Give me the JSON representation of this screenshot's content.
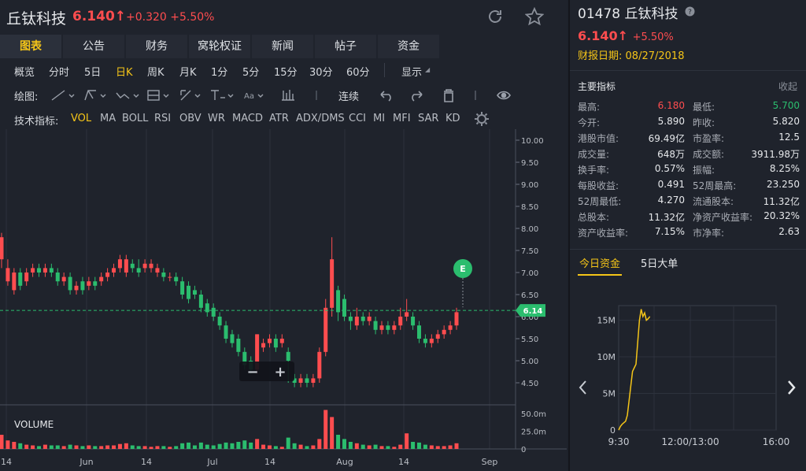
{
  "header": {
    "name": "丘钛科技",
    "price": "6.140",
    "change": "+0.320",
    "change_pct": "+5.50%"
  },
  "tabs": [
    "图表",
    "公告",
    "财务",
    "窝轮权证",
    "新闻",
    "帖子",
    "资金"
  ],
  "active_tab": 0,
  "periods": [
    "概览",
    "分时",
    "5日",
    "日K",
    "周K",
    "月K",
    "1分",
    "5分",
    "15分",
    "30分",
    "60分",
    "显示"
  ],
  "active_period": 3,
  "draw": {
    "label": "绘图:",
    "continuous": "连续"
  },
  "indicators": {
    "label": "技术指标:",
    "items": [
      "VOL",
      "MA",
      "BOLL",
      "RSI",
      "OBV",
      "WR",
      "MACD",
      "ATR",
      "ADX/DMS",
      "CCI",
      "MI",
      "MFI",
      "SAR",
      "KD"
    ],
    "active": 0
  },
  "chart_data": {
    "type": "candlestick",
    "price_axis": {
      "ticks": [
        "10.00",
        "9.50",
        "9.00",
        "8.50",
        "8.00",
        "7.50",
        "7.00",
        "6.50",
        "6.00",
        "5.50",
        "5.00",
        "4.50"
      ],
      "range": [
        4.0,
        10.25
      ]
    },
    "volume_axis": {
      "ticks": [
        "50.0m",
        "25.0m",
        "0"
      ],
      "range": [
        0,
        60
      ]
    },
    "x_labels": [
      "14",
      "Jun",
      "14",
      "Jul",
      "14",
      "Aug",
      "14",
      "Sep"
    ],
    "last_price_label": "6.14",
    "last_price": 6.14,
    "earnings_marker": "E",
    "volume_label": "VOLUME",
    "zoom_minus": "−",
    "zoom_plus": "+",
    "candles": [
      [
        7.3,
        7.8,
        7.9,
        7.1,
        20
      ],
      [
        6.8,
        7.1,
        7.3,
        6.7,
        12
      ],
      [
        6.6,
        7.0,
        7.1,
        6.5,
        10
      ],
      [
        7.0,
        6.7,
        7.1,
        6.6,
        8
      ],
      [
        6.8,
        7.0,
        7.1,
        6.7,
        6
      ],
      [
        7.0,
        7.1,
        7.2,
        6.9,
        5
      ],
      [
        7.1,
        7.0,
        7.2,
        6.9,
        4
      ],
      [
        7.0,
        7.1,
        7.2,
        6.9,
        6
      ],
      [
        7.1,
        7.0,
        7.2,
        6.9,
        5
      ],
      [
        7.0,
        6.8,
        7.1,
        6.7,
        5
      ],
      [
        6.8,
        6.9,
        7.0,
        6.7,
        4
      ],
      [
        6.9,
        6.6,
        7.0,
        6.5,
        6
      ],
      [
        6.6,
        6.7,
        6.8,
        6.5,
        5
      ],
      [
        6.8,
        6.6,
        6.9,
        6.5,
        4
      ],
      [
        6.7,
        6.8,
        6.9,
        6.6,
        5
      ],
      [
        6.8,
        6.7,
        6.9,
        6.6,
        4
      ],
      [
        6.8,
        6.9,
        7.0,
        6.7,
        4
      ],
      [
        6.9,
        7.0,
        7.1,
        6.8,
        5
      ],
      [
        7.0,
        7.1,
        7.2,
        6.9,
        5
      ],
      [
        7.1,
        7.3,
        7.4,
        7.0,
        7
      ],
      [
        7.0,
        7.3,
        7.4,
        6.9,
        8
      ],
      [
        7.2,
        7.1,
        7.3,
        7.0,
        5
      ],
      [
        7.1,
        7.0,
        7.3,
        6.9,
        4
      ],
      [
        7.1,
        7.2,
        7.3,
        7.0,
        4
      ],
      [
        7.1,
        7.2,
        7.3,
        7.0,
        3
      ],
      [
        7.0,
        7.1,
        7.2,
        6.9,
        4
      ],
      [
        7.0,
        6.9,
        7.1,
        6.8,
        4
      ],
      [
        6.9,
        6.9,
        7.0,
        6.8,
        3
      ],
      [
        6.9,
        6.8,
        7.0,
        6.7,
        4
      ],
      [
        6.8,
        6.5,
        6.9,
        6.4,
        8
      ],
      [
        6.7,
        6.4,
        6.8,
        6.3,
        9
      ],
      [
        6.6,
        6.5,
        6.7,
        6.4,
        5
      ],
      [
        6.5,
        6.2,
        6.6,
        6.1,
        9
      ],
      [
        6.3,
        6.1,
        6.4,
        6.0,
        6
      ],
      [
        6.2,
        6.0,
        6.3,
        5.9,
        5
      ],
      [
        6.0,
        5.8,
        6.1,
        5.7,
        7
      ],
      [
        5.8,
        5.5,
        5.9,
        5.4,
        9
      ],
      [
        5.6,
        5.4,
        5.7,
        5.3,
        8
      ],
      [
        5.5,
        5.2,
        5.6,
        5.1,
        10
      ],
      [
        5.2,
        4.9,
        5.3,
        4.8,
        12
      ],
      [
        5.0,
        4.8,
        5.1,
        4.7,
        9
      ],
      [
        4.8,
        5.6,
        5.6,
        4.7,
        14
      ],
      [
        5.3,
        5.4,
        5.5,
        5.2,
        6
      ],
      [
        5.4,
        5.5,
        5.6,
        5.3,
        5
      ],
      [
        5.5,
        5.3,
        5.6,
        5.2,
        4
      ],
      [
        5.4,
        5.5,
        5.6,
        5.3,
        3
      ],
      [
        5.2,
        5.0,
        5.3,
        4.5,
        16
      ],
      [
        4.6,
        4.5,
        4.7,
        4.4,
        8
      ],
      [
        4.5,
        4.6,
        4.7,
        4.4,
        6
      ],
      [
        4.6,
        4.5,
        4.7,
        4.4,
        4
      ],
      [
        4.5,
        4.6,
        4.7,
        4.4,
        5
      ],
      [
        4.6,
        5.2,
        5.3,
        4.5,
        14
      ],
      [
        5.2,
        6.2,
        6.4,
        5.1,
        55
      ],
      [
        6.2,
        7.3,
        7.8,
        6.0,
        45
      ],
      [
        6.6,
        6.1,
        6.7,
        5.9,
        20
      ],
      [
        6.4,
        6.0,
        6.5,
        5.9,
        14
      ],
      [
        6.0,
        5.9,
        6.1,
        5.7,
        10
      ],
      [
        5.8,
        6.0,
        6.2,
        5.7,
        8
      ],
      [
        6.0,
        5.9,
        6.1,
        5.8,
        6
      ],
      [
        5.9,
        6.0,
        6.1,
        5.8,
        5
      ],
      [
        5.9,
        5.7,
        6.0,
        5.6,
        6
      ],
      [
        5.7,
        5.8,
        5.9,
        5.6,
        4
      ],
      [
        5.8,
        5.7,
        5.9,
        5.6,
        4
      ],
      [
        5.7,
        5.8,
        5.9,
        5.6,
        3
      ],
      [
        5.8,
        6.0,
        6.2,
        5.7,
        6
      ],
      [
        6.0,
        6.1,
        6.4,
        5.9,
        22
      ],
      [
        6.0,
        5.8,
        6.1,
        5.7,
        10
      ],
      [
        5.8,
        5.5,
        5.9,
        5.4,
        9
      ],
      [
        5.5,
        5.4,
        5.6,
        5.3,
        6
      ],
      [
        5.4,
        5.5,
        5.6,
        5.3,
        5
      ],
      [
        5.5,
        5.6,
        5.7,
        5.4,
        4
      ],
      [
        5.6,
        5.7,
        5.8,
        5.5,
        4
      ],
      [
        5.7,
        5.8,
        5.9,
        5.6,
        5
      ],
      [
        5.8,
        6.1,
        6.2,
        5.7,
        8
      ]
    ]
  },
  "right": {
    "code": "01478",
    "name": "丘钛科技",
    "price": "6.140",
    "change_pct": "+5.50%",
    "report_label": "财报日期:",
    "report_date": "08/27/2018",
    "metrics_title": "主要指标",
    "collapse": "收起",
    "metrics": [
      [
        "最高:",
        "6.180",
        "最低:",
        "5.700"
      ],
      [
        "今开:",
        "5.890",
        "昨收:",
        "5.820"
      ],
      [
        "港股市值:",
        "69.49亿",
        "市盈率:",
        "12.5"
      ],
      [
        "成交量:",
        "648万",
        "成交额:",
        "3911.98万"
      ],
      [
        "换手率:",
        "0.57%",
        "振幅:",
        "8.25%"
      ],
      [
        "每股收益:",
        "0.491",
        "52周最高:",
        "23.250"
      ],
      [
        "52周最低:",
        "4.270",
        "流通股本:",
        "11.32亿"
      ],
      [
        "总股本:",
        "11.32亿",
        "净资产收益率:",
        "20.32%"
      ],
      [
        "资产收益率:",
        "7.15%",
        "市净率:",
        "2.63"
      ]
    ],
    "tabs": [
      "今日资金",
      "5日大单"
    ],
    "flow_chart": {
      "type": "line",
      "y_ticks": [
        "15M",
        "10M",
        "5M",
        "0"
      ],
      "x_labels": [
        "9:30",
        "12:00/13:00",
        "16:00"
      ],
      "ylim": [
        0,
        17
      ],
      "values": [
        0,
        0.5,
        0.8,
        1,
        1.2,
        2,
        4,
        6,
        8,
        8.5,
        9,
        12,
        15,
        16.5,
        15.5,
        16,
        15,
        15.2,
        15.5
      ]
    }
  },
  "colors": {
    "up": "#ff4d4f",
    "down": "#2bbd6e",
    "accent": "#f5c518",
    "grid": "#2d323d",
    "text": "#c8ccd3"
  }
}
